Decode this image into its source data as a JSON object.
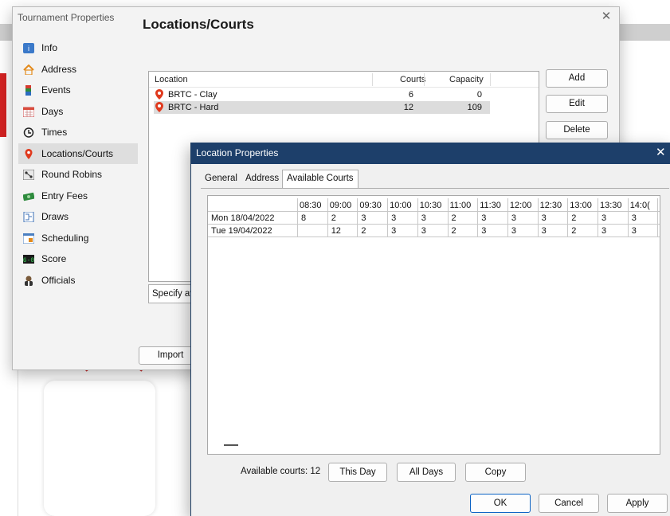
{
  "tournament_dialog": {
    "title": "Tournament Properties",
    "heading": "Locations/Courts",
    "nav": [
      {
        "label": "Info",
        "icon": "info-icon",
        "selected": false
      },
      {
        "label": "Address",
        "icon": "home-icon",
        "selected": false
      },
      {
        "label": "Events",
        "icon": "events-icon",
        "selected": false
      },
      {
        "label": "Days",
        "icon": "calendar-icon",
        "selected": false
      },
      {
        "label": "Times",
        "icon": "clock-icon",
        "selected": false
      },
      {
        "label": "Locations/Courts",
        "icon": "location-pin-icon",
        "selected": true
      },
      {
        "label": "Round Robins",
        "icon": "round-robin-icon",
        "selected": false
      },
      {
        "label": "Entry Fees",
        "icon": "money-icon",
        "selected": false
      },
      {
        "label": "Draws",
        "icon": "draws-icon",
        "selected": false
      },
      {
        "label": "Scheduling",
        "icon": "scheduling-icon",
        "selected": false
      },
      {
        "label": "Score",
        "icon": "score-icon",
        "selected": false
      },
      {
        "label": "Officials",
        "icon": "official-icon",
        "selected": false
      }
    ],
    "location_list": {
      "columns": [
        "Location",
        "Courts",
        "Capacity"
      ],
      "rows": [
        {
          "name": "BRTC - Clay",
          "courts": "6",
          "capacity": "0",
          "selected": false
        },
        {
          "name": "BRTC - Hard",
          "courts": "12",
          "capacity": "109",
          "selected": true
        }
      ]
    },
    "buttons": {
      "add": "Add",
      "edit": "Edit",
      "delete": "Delete",
      "import": "Import"
    },
    "specify_text": "Specify av"
  },
  "location_dialog": {
    "title": "Location Properties",
    "tabs": [
      "General",
      "Address",
      "Available Courts"
    ],
    "active_tab": "Available Courts",
    "times": [
      "08:30",
      "09:00",
      "09:30",
      "10:00",
      "10:30",
      "11:00",
      "11:30",
      "12:00",
      "12:30",
      "13:00",
      "13:30",
      "14:0("
    ],
    "rows": [
      {
        "day": "Mon 18/04/2022",
        "values": [
          "8",
          "2",
          "3",
          "3",
          "3",
          "2",
          "3",
          "3",
          "3",
          "2",
          "3",
          "3"
        ]
      },
      {
        "day": "Tue 19/04/2022",
        "values": [
          "",
          "12",
          "2",
          "3",
          "3",
          "2",
          "3",
          "3",
          "3",
          "2",
          "3",
          "3"
        ]
      }
    ],
    "available_courts": "Available courts: 12",
    "buttons": {
      "this_day": "This Day",
      "all_days": "All Days",
      "copy": "Copy",
      "ok": "OK",
      "cancel": "Cancel",
      "apply": "Apply"
    }
  },
  "colors": {
    "title_bar": "#1d3f6a",
    "pin": "#e03a1e",
    "selection": "#dcdcdc"
  }
}
